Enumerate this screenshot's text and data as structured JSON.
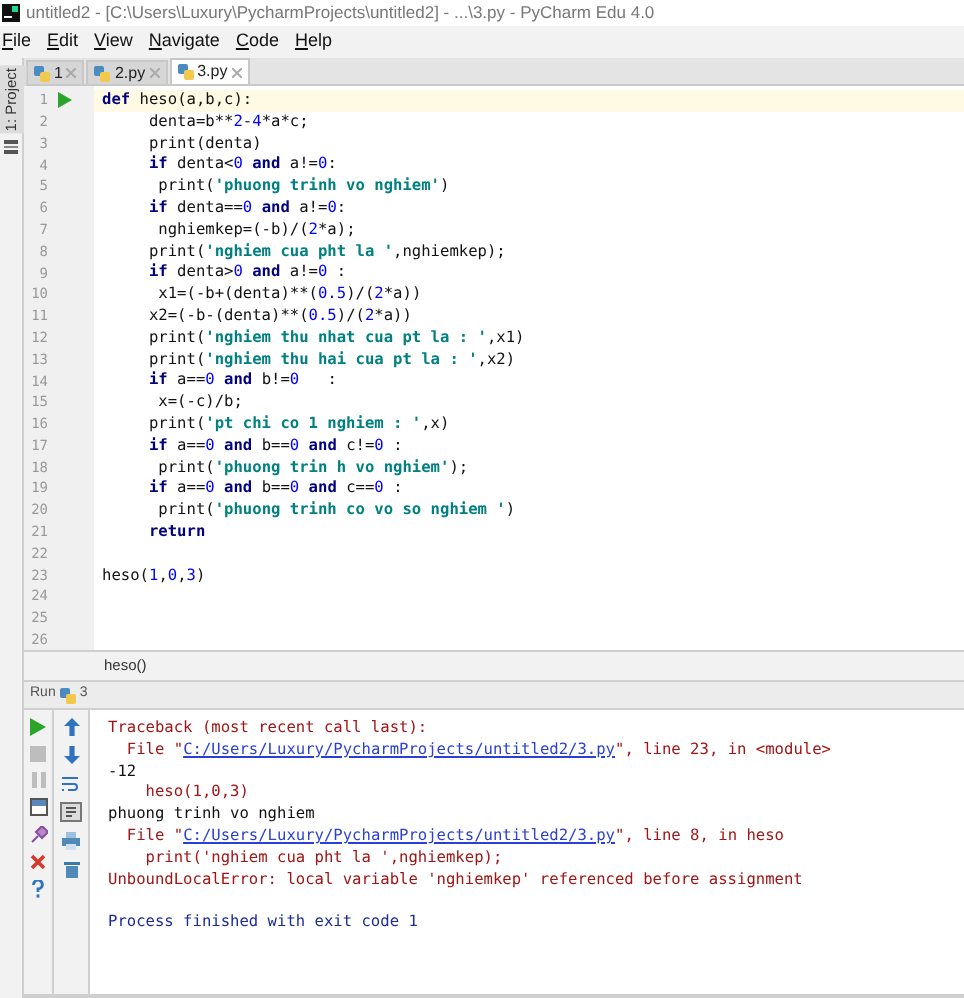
{
  "window": {
    "title": "untitled2 - [C:\\Users\\Luxury\\PycharmProjects\\untitled2] - ...\\3.py - PyCharm Edu 4.0"
  },
  "menu": [
    "File",
    "Edit",
    "View",
    "Navigate",
    "Code",
    "Help"
  ],
  "tool_strip": {
    "label": "1: Project"
  },
  "tabs": [
    {
      "label": "1",
      "selected": false
    },
    {
      "label": "2.py",
      "selected": false
    },
    {
      "label": "3.py",
      "selected": true
    }
  ],
  "editor": {
    "lines": [
      {
        "number": "1",
        "current": true,
        "segments": [
          {
            "text": "def",
            "kind": "kw"
          },
          {
            "text": " heso(a,b,c):",
            "kind": "p"
          }
        ]
      },
      {
        "number": "2",
        "current": false,
        "segments": [
          {
            "text": "     denta=b**",
            "kind": "p"
          },
          {
            "text": "2",
            "kind": "num"
          },
          {
            "text": "-",
            "kind": "p"
          },
          {
            "text": "4",
            "kind": "num"
          },
          {
            "text": "*a*c;",
            "kind": "p"
          }
        ]
      },
      {
        "number": "3",
        "current": false,
        "segments": [
          {
            "text": "     print(denta)",
            "kind": "p"
          }
        ]
      },
      {
        "number": "4",
        "current": false,
        "segments": [
          {
            "text": "     if",
            "kind": "kw"
          },
          {
            "text": " denta<",
            "kind": "p"
          },
          {
            "text": "0",
            "kind": "num"
          },
          {
            "text": " and",
            "kind": "kw"
          },
          {
            "text": " a!=",
            "kind": "p"
          },
          {
            "text": "0",
            "kind": "num"
          },
          {
            "text": ":",
            "kind": "p"
          }
        ]
      },
      {
        "number": "5",
        "current": false,
        "segments": [
          {
            "text": "      print(",
            "kind": "p"
          },
          {
            "text": "'phuong trinh vo nghiem'",
            "kind": "str"
          },
          {
            "text": ")",
            "kind": "p"
          }
        ]
      },
      {
        "number": "6",
        "current": false,
        "segments": [
          {
            "text": "     if",
            "kind": "kw"
          },
          {
            "text": " denta==",
            "kind": "p"
          },
          {
            "text": "0",
            "kind": "num"
          },
          {
            "text": " and",
            "kind": "kw"
          },
          {
            "text": " a!=",
            "kind": "p"
          },
          {
            "text": "0",
            "kind": "num"
          },
          {
            "text": ":",
            "kind": "p"
          }
        ]
      },
      {
        "number": "7",
        "current": false,
        "segments": [
          {
            "text": "      nghiemkep=(-b)/(",
            "kind": "p"
          },
          {
            "text": "2",
            "kind": "num"
          },
          {
            "text": "*a);",
            "kind": "p"
          }
        ]
      },
      {
        "number": "8",
        "current": false,
        "segments": [
          {
            "text": "     print(",
            "kind": "p"
          },
          {
            "text": "'nghiem cua pht la '",
            "kind": "str"
          },
          {
            "text": ",nghiemkep);",
            "kind": "p"
          }
        ]
      },
      {
        "number": "9",
        "current": false,
        "segments": [
          {
            "text": "     if",
            "kind": "kw"
          },
          {
            "text": " denta>",
            "kind": "p"
          },
          {
            "text": "0",
            "kind": "num"
          },
          {
            "text": " and",
            "kind": "kw"
          },
          {
            "text": " a!=",
            "kind": "p"
          },
          {
            "text": "0",
            "kind": "num"
          },
          {
            "text": " :",
            "kind": "p"
          }
        ]
      },
      {
        "number": "10",
        "current": false,
        "segments": [
          {
            "text": "      x1=(-b+(denta)**(",
            "kind": "p"
          },
          {
            "text": "0.5",
            "kind": "num"
          },
          {
            "text": ")/(",
            "kind": "p"
          },
          {
            "text": "2",
            "kind": "num"
          },
          {
            "text": "*a))",
            "kind": "p"
          }
        ]
      },
      {
        "number": "11",
        "current": false,
        "segments": [
          {
            "text": "     x2=(-b-(denta)**(",
            "kind": "p"
          },
          {
            "text": "0.5",
            "kind": "num"
          },
          {
            "text": ")/(",
            "kind": "p"
          },
          {
            "text": "2",
            "kind": "num"
          },
          {
            "text": "*a))",
            "kind": "p"
          }
        ]
      },
      {
        "number": "12",
        "current": false,
        "segments": [
          {
            "text": "     print(",
            "kind": "p"
          },
          {
            "text": "'nghiem thu nhat cua pt la : '",
            "kind": "str"
          },
          {
            "text": ",x1)",
            "kind": "p"
          }
        ]
      },
      {
        "number": "13",
        "current": false,
        "segments": [
          {
            "text": "     print(",
            "kind": "p"
          },
          {
            "text": "'nghiem thu hai cua pt la : '",
            "kind": "str"
          },
          {
            "text": ",x2)",
            "kind": "p"
          }
        ]
      },
      {
        "number": "14",
        "current": false,
        "segments": [
          {
            "text": "     if",
            "kind": "kw"
          },
          {
            "text": " a==",
            "kind": "p"
          },
          {
            "text": "0",
            "kind": "num"
          },
          {
            "text": " and",
            "kind": "kw"
          },
          {
            "text": " b!=",
            "kind": "p"
          },
          {
            "text": "0",
            "kind": "num"
          },
          {
            "text": "   :",
            "kind": "p"
          }
        ]
      },
      {
        "number": "15",
        "current": false,
        "segments": [
          {
            "text": "      x=(-c)/b;",
            "kind": "p"
          }
        ]
      },
      {
        "number": "16",
        "current": false,
        "segments": [
          {
            "text": "     print(",
            "kind": "p"
          },
          {
            "text": "'pt chi co 1 nghiem : '",
            "kind": "str"
          },
          {
            "text": ",x)",
            "kind": "p"
          }
        ]
      },
      {
        "number": "17",
        "current": false,
        "segments": [
          {
            "text": "     if",
            "kind": "kw"
          },
          {
            "text": " a==",
            "kind": "p"
          },
          {
            "text": "0",
            "kind": "num"
          },
          {
            "text": " and",
            "kind": "kw"
          },
          {
            "text": " b==",
            "kind": "p"
          },
          {
            "text": "0",
            "kind": "num"
          },
          {
            "text": " and",
            "kind": "kw"
          },
          {
            "text": " c!=",
            "kind": "p"
          },
          {
            "text": "0",
            "kind": "num"
          },
          {
            "text": " :",
            "kind": "p"
          }
        ]
      },
      {
        "number": "18",
        "current": false,
        "segments": [
          {
            "text": "      print(",
            "kind": "p"
          },
          {
            "text": "'phuong trin h vo nghiem'",
            "kind": "str"
          },
          {
            "text": ");",
            "kind": "p"
          }
        ]
      },
      {
        "number": "19",
        "current": false,
        "segments": [
          {
            "text": "     if",
            "kind": "kw"
          },
          {
            "text": " a==",
            "kind": "p"
          },
          {
            "text": "0",
            "kind": "num"
          },
          {
            "text": " and",
            "kind": "kw"
          },
          {
            "text": " b==",
            "kind": "p"
          },
          {
            "text": "0",
            "kind": "num"
          },
          {
            "text": " and",
            "kind": "kw"
          },
          {
            "text": " c==",
            "kind": "p"
          },
          {
            "text": "0",
            "kind": "num"
          },
          {
            "text": " :",
            "kind": "p"
          }
        ]
      },
      {
        "number": "20",
        "current": false,
        "segments": [
          {
            "text": "      print(",
            "kind": "p"
          },
          {
            "text": "'phuong trinh co vo so nghiem '",
            "kind": "str"
          },
          {
            "text": ")",
            "kind": "p"
          }
        ]
      },
      {
        "number": "21",
        "current": false,
        "segments": [
          {
            "text": "     return",
            "kind": "kw"
          }
        ]
      },
      {
        "number": "22",
        "current": false
      },
      {
        "number": "23",
        "current": false,
        "segments": [
          {
            "text": "heso(",
            "kind": "p"
          },
          {
            "text": "1",
            "kind": "num"
          },
          {
            "text": ",",
            "kind": "p"
          },
          {
            "text": "0",
            "kind": "num"
          },
          {
            "text": ",",
            "kind": "p"
          },
          {
            "text": "3",
            "kind": "num"
          },
          {
            "text": ")",
            "kind": "p"
          }
        ]
      },
      {
        "number": "24",
        "current": false
      },
      {
        "number": "25",
        "current": false
      },
      {
        "number": "26",
        "current": false
      }
    ]
  },
  "breadcrumb": "heso()",
  "run_panel": {
    "title": "Run",
    "config": "3",
    "console": [
      {
        "kind": "err",
        "parts": [
          {
            "text": "Traceback (most recent call last):",
            "kind": "text"
          }
        ]
      },
      {
        "kind": "err",
        "parts": [
          {
            "text": "  File \"",
            "kind": "text"
          },
          {
            "text": "C:/Users/Luxury/PycharmProjects/untitled2/3.py",
            "kind": "link"
          },
          {
            "text": "\", line 23, in <module>",
            "kind": "text"
          }
        ]
      },
      {
        "kind": "out",
        "parts": [
          {
            "text": "-12",
            "kind": "text"
          }
        ]
      },
      {
        "kind": "err",
        "parts": [
          {
            "text": "    heso(1,0,3)",
            "kind": "text"
          }
        ]
      },
      {
        "kind": "out",
        "parts": [
          {
            "text": "phuong trinh vo nghiem",
            "kind": "text"
          }
        ]
      },
      {
        "kind": "err",
        "parts": [
          {
            "text": "  File \"",
            "kind": "text"
          },
          {
            "text": "C:/Users/Luxury/PycharmProjects/untitled2/3.py",
            "kind": "link"
          },
          {
            "text": "\", line 8, in heso",
            "kind": "text"
          }
        ]
      },
      {
        "kind": "err",
        "parts": [
          {
            "text": "    print('nghiem cua pht la ',nghiemkep);",
            "kind": "text"
          }
        ]
      },
      {
        "kind": "err",
        "parts": [
          {
            "text": "UnboundLocalError: local variable 'nghiemkep' referenced before assignment",
            "kind": "text"
          }
        ]
      },
      {
        "kind": "info",
        "parts": [
          {
            "text": "Process finished with exit code 1",
            "kind": "text"
          }
        ]
      }
    ]
  }
}
